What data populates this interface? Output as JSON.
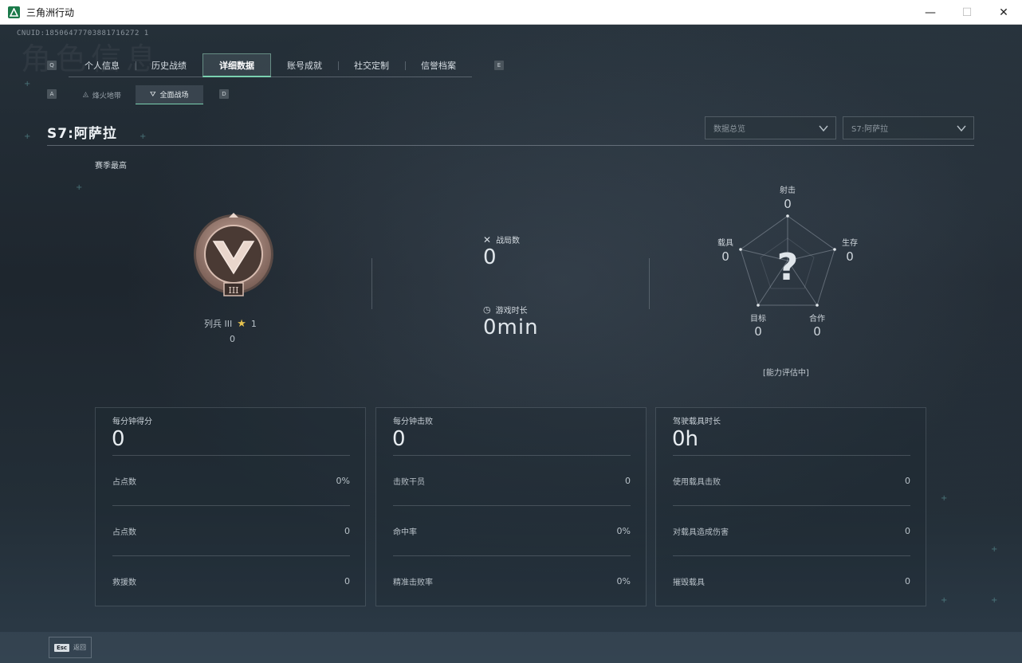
{
  "window": {
    "title": "三角洲行动",
    "minimize": "—",
    "maximize": "☐",
    "close": "✕"
  },
  "header": {
    "uid": "CNUID:18506477703881716272 1",
    "ghost_title": "角色信息",
    "key_left": "Q",
    "key_right": "E",
    "sub_key_left": "A",
    "sub_key_right": "D"
  },
  "tabs": [
    {
      "label": "个人信息"
    },
    {
      "label": "历史战绩"
    },
    {
      "label": "详细数据"
    },
    {
      "label": "账号成就"
    },
    {
      "label": "社交定制"
    },
    {
      "label": "信誉档案"
    }
  ],
  "subtabs": [
    {
      "label": "烽火地带"
    },
    {
      "label": "全面战场"
    }
  ],
  "season": {
    "title": "S7:阿萨拉",
    "dropdown_left": "数据总览",
    "dropdown_right": "S7:阿萨拉",
    "season_high": "赛季最高"
  },
  "rank": {
    "name": "列兵 III",
    "stars": "1",
    "score": "0",
    "badge_numeral": "III"
  },
  "stats": {
    "matches_label": "战局数",
    "matches_value": "0",
    "playtime_label": "游戏时长",
    "playtime_value": "0min"
  },
  "radar": {
    "unknown": "?",
    "ability_status": "[能力评估中]",
    "axes": [
      {
        "label": "射击",
        "value": "0"
      },
      {
        "label": "生存",
        "value": "0"
      },
      {
        "label": "合作",
        "value": "0"
      },
      {
        "label": "目标",
        "value": "0"
      },
      {
        "label": "载具",
        "value": "0"
      }
    ]
  },
  "panels": [
    {
      "title": "每分钟得分",
      "value": "0",
      "rows": [
        {
          "label": "占点数",
          "value": "0%"
        },
        {
          "label": "占点数",
          "value": "0"
        },
        {
          "label": "救援数",
          "value": "0"
        }
      ]
    },
    {
      "title": "每分钟击败",
      "value": "0",
      "rows": [
        {
          "label": "击败干员",
          "value": "0"
        },
        {
          "label": "命中率",
          "value": "0%"
        },
        {
          "label": "精准击败率",
          "value": "0%"
        }
      ]
    },
    {
      "title": "驾驶载具时长",
      "value": "0h",
      "rows": [
        {
          "label": "使用载具击败",
          "value": "0"
        },
        {
          "label": "对载具造成伤害",
          "value": "0"
        },
        {
          "label": "摧毁载具",
          "value": "0"
        }
      ]
    }
  ],
  "footer": {
    "esc_key": "Esc",
    "back_label": "返回"
  },
  "colors": {
    "accent": "#7ad1b0",
    "background": "#1c232b",
    "rank_bronze": "#a8877c"
  }
}
